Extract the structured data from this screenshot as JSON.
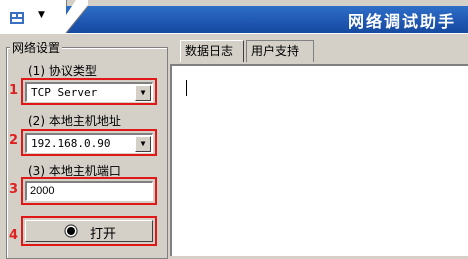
{
  "window": {
    "title": "网络调试助手"
  },
  "group": {
    "title": "网络设置"
  },
  "fields": [
    {
      "marker": "1",
      "label": "(1) 协议类型",
      "value": "TCP Server"
    },
    {
      "marker": "2",
      "label": "(2) 本地主机地址",
      "value": "192.168.0.90"
    },
    {
      "marker": "3",
      "label": "(3) 本地主机端口",
      "value": "2000"
    }
  ],
  "open_button": {
    "marker": "4",
    "label": "打开"
  },
  "tabs": [
    {
      "label": "数据日志"
    },
    {
      "label": "用户支持"
    }
  ],
  "colors": {
    "title_blue": "#1e56b0",
    "highlight_red": "#e01818",
    "panel": "#d4d0c8"
  }
}
